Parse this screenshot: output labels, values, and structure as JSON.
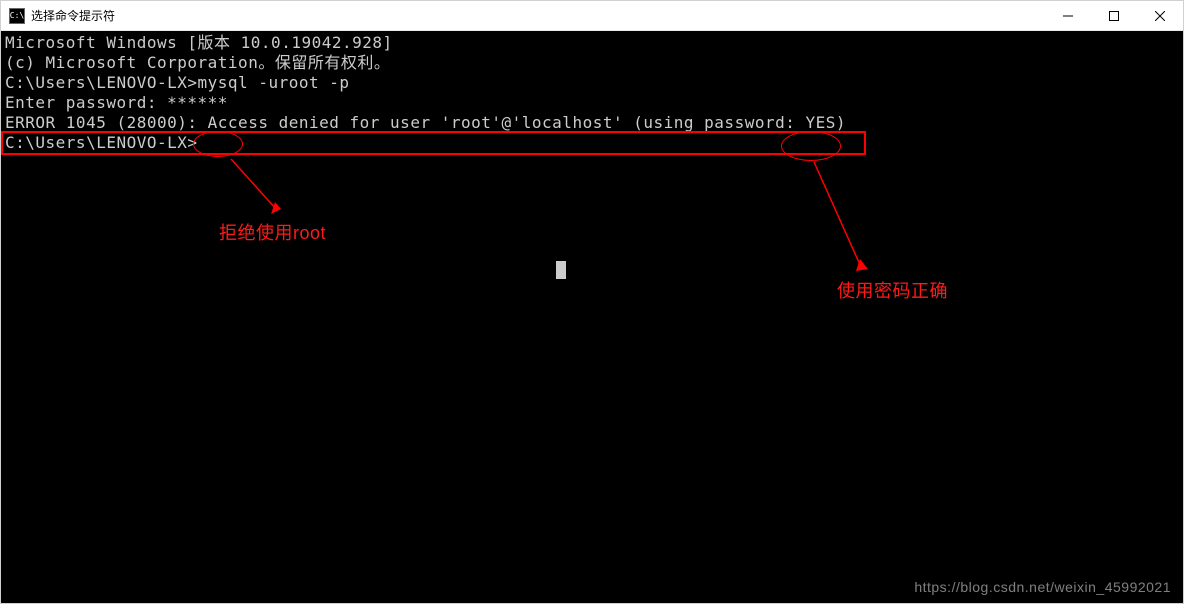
{
  "title": "选择命令提示符",
  "icon_label": "C:\\",
  "terminal": {
    "line1": "Microsoft Windows [版本 10.0.19042.928]",
    "line2": "(c) Microsoft Corporation。保留所有权利。",
    "empty": "",
    "prompt1": "C:\\Users\\LENOVO-LX>mysql -uroot -p",
    "enter_pw": "Enter password: ******",
    "error": "ERROR 1045 (28000): Access denied for user 'root'@'localhost' (using password: YES)",
    "prompt2": "C:\\Users\\LENOVO-LX>"
  },
  "annotations": {
    "deny_root": "拒绝使用root",
    "password_ok": "使用密码正确"
  },
  "watermark": "https://blog.csdn.net/weixin_45992021"
}
